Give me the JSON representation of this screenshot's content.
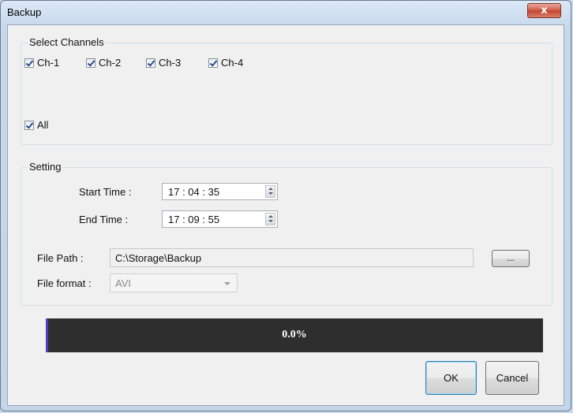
{
  "window": {
    "title": "Backup",
    "close_symbol": "x"
  },
  "channels": {
    "group_label": "Select Channels",
    "items": [
      {
        "label": "Ch-1",
        "checked": true
      },
      {
        "label": "Ch-2",
        "checked": true
      },
      {
        "label": "Ch-3",
        "checked": true
      },
      {
        "label": "Ch-4",
        "checked": true
      }
    ],
    "all": {
      "label": "All",
      "checked": true
    }
  },
  "setting": {
    "group_label": "Setting",
    "start_time_label": "Start Time :",
    "start_time": "17 : 04 : 35",
    "end_time_label": "End Time  :",
    "end_time": "17 : 09 : 55",
    "file_path_label": "File Path :",
    "file_path": "C:\\Storage\\Backup",
    "browse_label": "...",
    "file_format_label": "File format :",
    "file_format": "AVI"
  },
  "progress": {
    "text": "0.0%",
    "value": 0.0,
    "bar_color": "#2e2e2e",
    "fill_color": "#4a3fb8"
  },
  "buttons": {
    "ok": "OK",
    "cancel": "Cancel"
  },
  "colors": {
    "close_button": "#c1422c",
    "frame": "#c7d8ec"
  }
}
